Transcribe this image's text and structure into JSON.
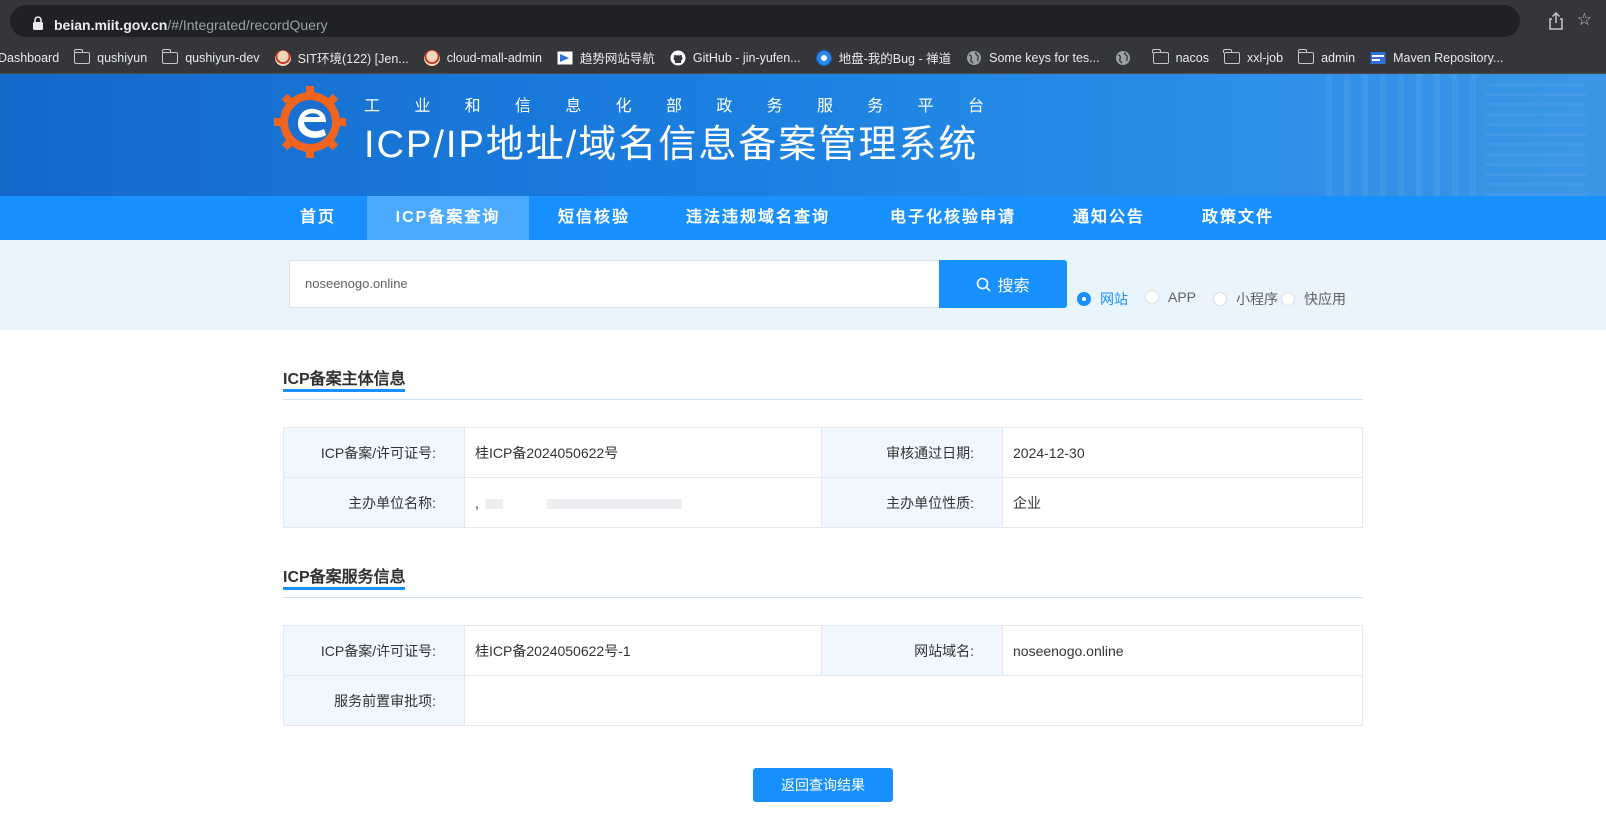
{
  "browser": {
    "url_host": "beian.miit.gov.cn",
    "url_path": "/#/Integrated/recordQuery",
    "bookmarks": [
      {
        "label": "Dashboard",
        "icon": "none"
      },
      {
        "label": "qushiyun",
        "icon": "folder-icon"
      },
      {
        "label": "qushiyun-dev",
        "icon": "folder-icon"
      },
      {
        "label": "SIT环境(122) [Jen...",
        "icon": "jenkins-icon"
      },
      {
        "label": "cloud-mall-admin",
        "icon": "jenkins-icon"
      },
      {
        "label": "趋势网站导航",
        "icon": "nav-site-icon"
      },
      {
        "label": "GitHub - jin-yufen...",
        "icon": "github-icon"
      },
      {
        "label": "地盘-我的Bug - 禅道",
        "icon": "zentao-icon"
      },
      {
        "label": "Some keys for tes...",
        "icon": "globe-icon"
      },
      {
        "label": "",
        "icon": "globe-icon"
      },
      {
        "label": "nacos",
        "icon": "folder-icon"
      },
      {
        "label": "xxl-job",
        "icon": "folder-icon"
      },
      {
        "label": "admin",
        "icon": "folder-icon"
      },
      {
        "label": "Maven Repository...",
        "icon": "maven-icon"
      }
    ]
  },
  "header": {
    "subtitle_chars": [
      "工",
      "业",
      "和",
      "信",
      "息",
      "化",
      "部",
      "政",
      "务",
      "服",
      "务",
      "平",
      "台"
    ],
    "title": "ICP/IP地址/域名信息备案管理系统"
  },
  "nav": {
    "items": [
      "首页",
      "ICP备案查询",
      "短信核验",
      "违法违规域名查询",
      "电子化核验申请",
      "通知公告",
      "政策文件"
    ],
    "active": "ICP备案查询"
  },
  "search": {
    "value": "noseenogo.online",
    "button_label": "搜索",
    "types": [
      "网站",
      "APP",
      "小程序",
      "快应用"
    ],
    "selected_type": "网站"
  },
  "subject_info": {
    "title": "ICP备案主体信息",
    "license_label": "ICP备案/许可证号:",
    "license_value": "桂ICP备2024050622号",
    "approve_date_label": "审核通过日期:",
    "approve_date_value": "2024-12-30",
    "org_name_label": "主办单位名称:",
    "org_name_value": ",",
    "org_type_label": "主办单位性质:",
    "org_type_value": "企业"
  },
  "service_info": {
    "title": "ICP备案服务信息",
    "license_label": "ICP备案/许可证号:",
    "license_value": "桂ICP备2024050622号-1",
    "domain_label": "网站域名:",
    "domain_value": "noseenogo.online",
    "preapproval_label": "服务前置审批项:",
    "preapproval_value": ""
  },
  "back_button_label": "返回查询结果",
  "colors": {
    "primary": "#1890ff",
    "nav_active": "#49aaff",
    "banner": "#1b7fe0",
    "logo_orange": "#f0641e"
  }
}
